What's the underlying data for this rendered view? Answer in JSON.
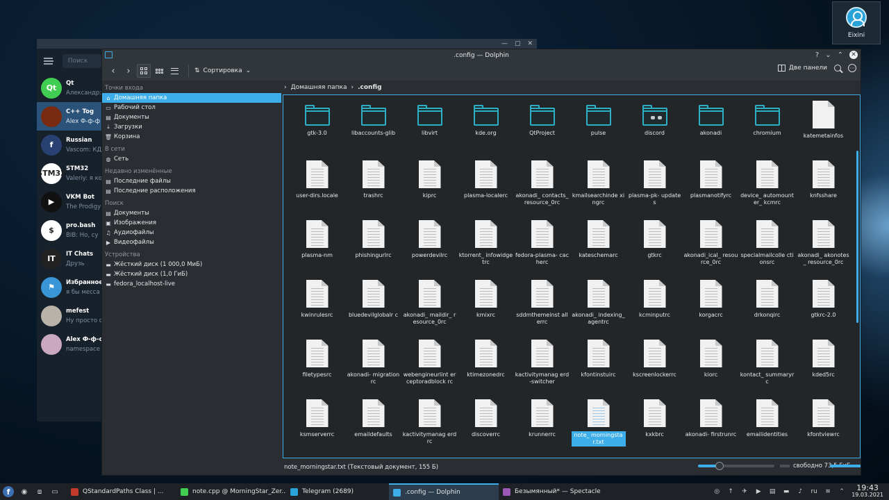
{
  "desktop": {
    "user_name": "Eixini"
  },
  "telegram": {
    "search_placeholder": "Поиск",
    "chats": [
      {
        "name": "Qt",
        "msg": "Александр:",
        "avatar_text": "Qt",
        "color": "#41cd52"
      },
      {
        "name": "C++ Tog",
        "msg": "Alex Ф-ф-ф",
        "avatar_text": "",
        "color": "#7a2a10"
      },
      {
        "name": "Russian",
        "msg": "Vascom: КД",
        "avatar_text": "f",
        "color": "#294172"
      },
      {
        "name": "STM32",
        "msg": "Valeriy: я ко",
        "avatar_text": "STM32",
        "color": "#ffffff"
      },
      {
        "name": "VKM Bot",
        "msg": "The Prodigy",
        "avatar_text": "▶",
        "color": "#111111"
      },
      {
        "name": "pro.bash",
        "msg": "BIB: Но, су",
        "avatar_text": "$",
        "color": "#ffffff"
      },
      {
        "name": "IT Chats",
        "msg": "Друзь",
        "avatar_text": "IT",
        "color": "#222222"
      },
      {
        "name": "Избранное",
        "msg": "я бы месса",
        "avatar_text": "⚑",
        "color": "#3a95d6"
      },
      {
        "name": "mefest",
        "msg": "Ну просто с",
        "avatar_text": "",
        "color": "#b9b2a8"
      },
      {
        "name": "Alex Ф-ф-ф",
        "msg": "namespace",
        "avatar_text": "",
        "color": "#c9a8c0"
      }
    ]
  },
  "dolphin": {
    "title": ".config — Dolphin",
    "toolbar": {
      "sort_label": "Сортировка",
      "panels_label": "Две панели"
    },
    "places": [
      {
        "section": "Точки входа",
        "items": [
          {
            "label": "Домашняя папка",
            "icon": "⌂",
            "selected": true
          },
          {
            "label": "Рабочий стол",
            "icon": "▭"
          },
          {
            "label": "Документы",
            "icon": "▤"
          },
          {
            "label": "Загрузки",
            "icon": "⤓"
          },
          {
            "label": "Корзина",
            "icon": "🗑"
          }
        ]
      },
      {
        "section": "В сети",
        "items": [
          {
            "label": "Сеть",
            "icon": "◍"
          }
        ]
      },
      {
        "section": "Недавно изменённые",
        "items": [
          {
            "label": "Последние файлы",
            "icon": "▤"
          },
          {
            "label": "Последние расположения",
            "icon": "▤"
          }
        ]
      },
      {
        "section": "Поиск",
        "items": [
          {
            "label": "Документы",
            "icon": "▤"
          },
          {
            "label": "Изображения",
            "icon": "▣"
          },
          {
            "label": "Аудиофайлы",
            "icon": "♫"
          },
          {
            "label": "Видеофайлы",
            "icon": "▶"
          }
        ]
      },
      {
        "section": "Устройства",
        "items": [
          {
            "label": "Жёсткий диск (1 000,0 МиБ)",
            "icon": "▬"
          },
          {
            "label": "Жёсткий диск (1,0 ГиБ)",
            "icon": "▬"
          },
          {
            "label": "fedora_localhost-live",
            "icon": "▬"
          }
        ]
      }
    ],
    "breadcrumb": {
      "home": "Домашняя папка",
      "current": ".config"
    },
    "items": [
      {
        "name": "gtk-3.0",
        "type": "folder"
      },
      {
        "name": "libaccounts-glib",
        "type": "folder"
      },
      {
        "name": "libvirt",
        "type": "folder"
      },
      {
        "name": "kde.org",
        "type": "folder"
      },
      {
        "name": "QtProject",
        "type": "folder"
      },
      {
        "name": "pulse",
        "type": "folder"
      },
      {
        "name": "discord",
        "type": "folder-discord"
      },
      {
        "name": "akonadi",
        "type": "folder"
      },
      {
        "name": "chromium",
        "type": "folder"
      },
      {
        "name": "katemetainfos",
        "type": "blank"
      },
      {
        "name": "user-dirs.locale",
        "type": "file"
      },
      {
        "name": "trashrc",
        "type": "file"
      },
      {
        "name": "kiprc",
        "type": "file"
      },
      {
        "name": "plasma-localerc",
        "type": "file"
      },
      {
        "name": "akonadi_ contacts_ resource_0rc",
        "type": "file"
      },
      {
        "name": "kmailsearchinde xingrc",
        "type": "file"
      },
      {
        "name": "plasma-pk- updates",
        "type": "file"
      },
      {
        "name": "plasmanotifyrc",
        "type": "file"
      },
      {
        "name": "device_ automounter_ kcmrc",
        "type": "file"
      },
      {
        "name": "knfsshare",
        "type": "file"
      },
      {
        "name": "plasma-nm",
        "type": "file"
      },
      {
        "name": "phishingurlrc",
        "type": "file"
      },
      {
        "name": "powerdevilrc",
        "type": "file"
      },
      {
        "name": "ktorrent_ infowidgetrc",
        "type": "file"
      },
      {
        "name": "fedora-plasma- cacherc",
        "type": "file"
      },
      {
        "name": "kateschemarc",
        "type": "file"
      },
      {
        "name": "gtkrc",
        "type": "file"
      },
      {
        "name": "akonadi_ical_ resource_0rc",
        "type": "file"
      },
      {
        "name": "specialmailcolle ctionsrc",
        "type": "file"
      },
      {
        "name": "akonadi_ akonotes_ resource_0rc",
        "type": "file"
      },
      {
        "name": "kwinrulesrc",
        "type": "file"
      },
      {
        "name": "bluedevilglobalr c",
        "type": "file"
      },
      {
        "name": "akonadi_ maildir_ resource_0rc",
        "type": "file"
      },
      {
        "name": "kmixrc",
        "type": "file"
      },
      {
        "name": "sddmthemeinst allerrc",
        "type": "file"
      },
      {
        "name": "akonadi_ indexing_ agentrc",
        "type": "file"
      },
      {
        "name": "kcminputrc",
        "type": "file"
      },
      {
        "name": "korgacrc",
        "type": "file"
      },
      {
        "name": "drkonqirc",
        "type": "file"
      },
      {
        "name": "gtkrc-2.0",
        "type": "file"
      },
      {
        "name": "filetypesrc",
        "type": "file"
      },
      {
        "name": "akonadi- migrationrc",
        "type": "file"
      },
      {
        "name": "webengineurlint erceptoradblock rc",
        "type": "file"
      },
      {
        "name": "ktimezonedrc",
        "type": "file"
      },
      {
        "name": "kactivitymanag erd-switcher",
        "type": "file"
      },
      {
        "name": "kfontinstuirc",
        "type": "file"
      },
      {
        "name": "kscreenlockerrc",
        "type": "file"
      },
      {
        "name": "kiorc",
        "type": "file"
      },
      {
        "name": "kontact_ summaryrc",
        "type": "file"
      },
      {
        "name": "kded5rc",
        "type": "file"
      },
      {
        "name": "ksmserverrc",
        "type": "file"
      },
      {
        "name": "emaildefaults",
        "type": "file"
      },
      {
        "name": "kactivitymanag erdrc",
        "type": "file"
      },
      {
        "name": "discoverrc",
        "type": "file"
      },
      {
        "name": "krunnerrc",
        "type": "file"
      },
      {
        "name": "note_ morningstar.txt",
        "type": "txt",
        "selected": true
      },
      {
        "name": "kxkbrc",
        "type": "file"
      },
      {
        "name": "akonadi- firstrunrc",
        "type": "file"
      },
      {
        "name": "emailidentities",
        "type": "file"
      },
      {
        "name": "kfontviewrc",
        "type": "file"
      },
      {
        "name": "",
        "type": "file"
      },
      {
        "name": "",
        "type": "file"
      },
      {
        "name": "",
        "type": "file"
      },
      {
        "name": "",
        "type": "file"
      },
      {
        "name": "",
        "type": "file"
      },
      {
        "name": "",
        "type": "file"
      },
      {
        "name": "",
        "type": "file"
      },
      {
        "name": "",
        "type": "file"
      },
      {
        "name": "",
        "type": "file"
      },
      {
        "name": "",
        "type": "file"
      }
    ],
    "status": {
      "text": "note_morningstar.txt (Текстовый документ, 155 Б)",
      "free": "свободно 73,5 ГиБ",
      "zoom_level": 0.28
    }
  },
  "taskbar": {
    "tasks": [
      {
        "label": "QStandardPaths Class | ...",
        "icon_color": "#c0392b"
      },
      {
        "label": "note.cpp @ MorningStar_Zer...",
        "icon_color": "#41cd52"
      },
      {
        "label": "Telegram (2689)",
        "icon_color": "#2aa4d8"
      },
      {
        "label": ".config — Dolphin",
        "icon_color": "#3daee9",
        "active": true
      },
      {
        "label": "Безымянный* — Spectacle",
        "icon_color": "#9b59b6"
      }
    ],
    "keyboard_layout": "ru",
    "time": "19:43",
    "date": "19.03.2021"
  }
}
